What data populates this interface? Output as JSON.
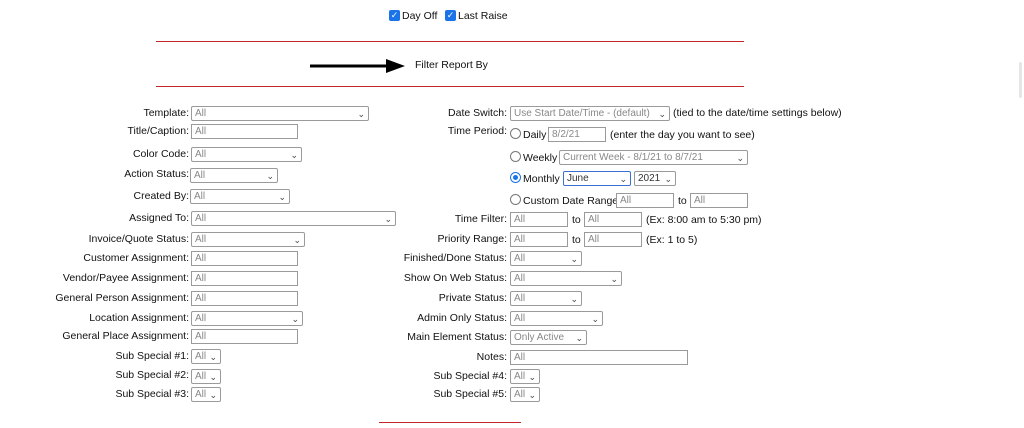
{
  "top": {
    "day_off": "Day Off",
    "last_raise": "Last Raise"
  },
  "filter_title": "Filter Report By",
  "left": {
    "template": {
      "label": "Template:",
      "value": "All"
    },
    "title_caption": {
      "label": "Title/Caption:",
      "value": "All"
    },
    "color_code": {
      "label": "Color Code:",
      "value": "All"
    },
    "action_status": {
      "label": "Action Status:",
      "value": "All"
    },
    "created_by": {
      "label": "Created By:",
      "value": "All"
    },
    "assigned_to": {
      "label": "Assigned To:",
      "value": "All"
    },
    "invoice_quote_status": {
      "label": "Invoice/Quote Status:",
      "value": "All"
    },
    "customer_assignment": {
      "label": "Customer Assignment:",
      "value": "All"
    },
    "vendor_payee_assignment": {
      "label": "Vendor/Payee Assignment:",
      "value": "All"
    },
    "general_person_assignment": {
      "label": "General Person Assignment:",
      "value": "All"
    },
    "location_assignment": {
      "label": "Location Assignment:",
      "value": "All"
    },
    "general_place_assignment": {
      "label": "General Place Assignment:",
      "value": "All"
    },
    "sub_special_1": {
      "label": "Sub Special #1:",
      "value": "All"
    },
    "sub_special_2": {
      "label": "Sub Special #2:",
      "value": "All"
    },
    "sub_special_3": {
      "label": "Sub Special #3:",
      "value": "All"
    }
  },
  "right": {
    "date_switch": {
      "label": "Date Switch:",
      "value": "Use Start Date/Time - (default)",
      "note": "(tied to the date/time settings below)"
    },
    "time_period": {
      "label": "Time Period:"
    },
    "daily": {
      "label": "Daily",
      "value": "8/2/21",
      "note": "(enter the day you want to see)"
    },
    "weekly": {
      "label": "Weekly",
      "value": "Current Week - 8/1/21 to 8/7/21"
    },
    "monthly": {
      "label": "Monthly",
      "month": "June",
      "year": "2021"
    },
    "custom": {
      "label": "Custom Date Range",
      "from": "All",
      "to_label": "to",
      "to": "All"
    },
    "time_filter": {
      "label": "Time Filter:",
      "from": "All",
      "to_label": "to",
      "to": "All",
      "note": "(Ex: 8:00 am to 5:30 pm)"
    },
    "priority_range": {
      "label": "Priority Range:",
      "from": "All",
      "to_label": "to",
      "to": "All",
      "note": "(Ex: 1 to 5)"
    },
    "finished_done_status": {
      "label": "Finished/Done Status:",
      "value": "All"
    },
    "show_on_web_status": {
      "label": "Show On Web Status:",
      "value": "All"
    },
    "private_status": {
      "label": "Private Status:",
      "value": "All"
    },
    "admin_only_status": {
      "label": "Admin Only Status:",
      "value": "All"
    },
    "main_element_status": {
      "label": "Main Element Status:",
      "value": "Only Active"
    },
    "notes": {
      "label": "Notes:",
      "value": "All"
    },
    "sub_special_4": {
      "label": "Sub Special #4:",
      "value": "All"
    },
    "sub_special_5": {
      "label": "Sub Special #5:",
      "value": "All"
    }
  }
}
